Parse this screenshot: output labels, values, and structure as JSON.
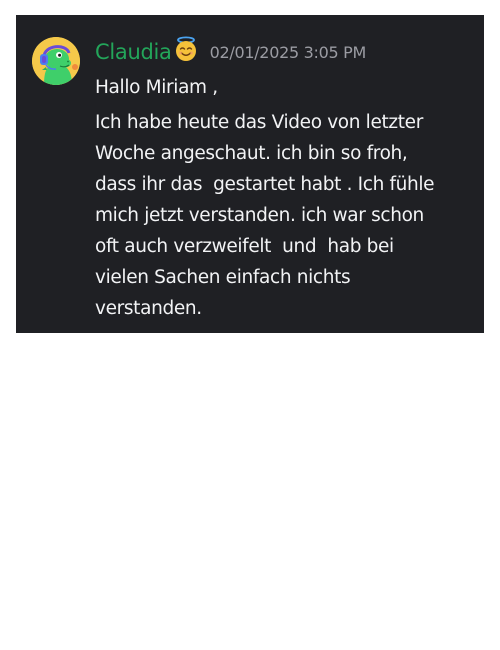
{
  "message": {
    "author": "Claudia",
    "author_color": "#23a55a",
    "author_emoji": "smiling-face-with-halo-icon",
    "timestamp": "02/01/2025 3:05 PM",
    "greeting": "Hallo Miriam ,",
    "paragraph_lines": [
      "Ich habe heute das Video von letzter",
      "Woche angeschaut. ich bin so froh,",
      "dass ihr das  gestartet habt . Ich fühle",
      "mich jetzt verstanden. ich war schon",
      "oft auch verzweifelt  und  hab bei",
      "vielen Sachen einfach nichts",
      "verstanden."
    ],
    "avatar": "green-dinosaur-headphones-avatar"
  },
  "colors": {
    "background": "#1f2024",
    "text": "#f2f3f5",
    "timestamp": "#9b9ca3",
    "avatar_bg": "#f5c94a"
  }
}
